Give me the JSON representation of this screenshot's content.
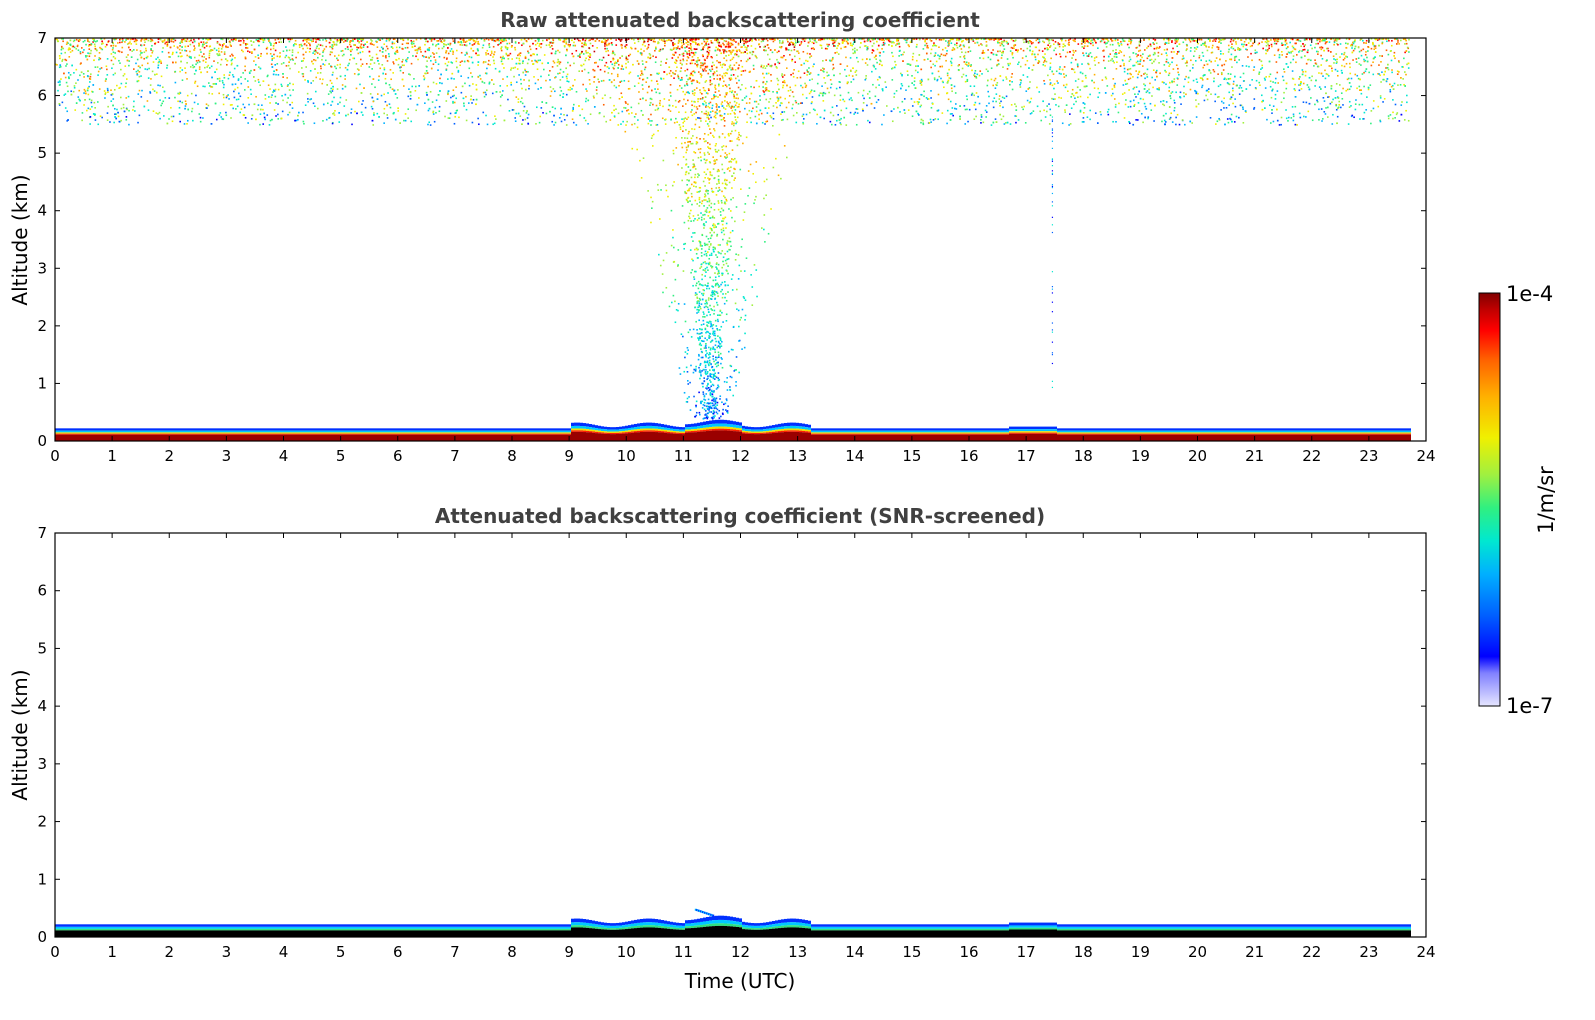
{
  "chart_data": [
    {
      "type": "heatmap",
      "title": "Raw attenuated backscattering coefficient",
      "ylabel": "Altitude (km)",
      "xlabel": "",
      "xlim": [
        0,
        24
      ],
      "ylim": [
        0,
        7
      ],
      "x_ticks": [
        0,
        1,
        2,
        3,
        4,
        5,
        6,
        7,
        8,
        9,
        10,
        11,
        12,
        13,
        14,
        15,
        16,
        17,
        18,
        19,
        20,
        21,
        22,
        23,
        24
      ],
      "y_ticks": [
        0,
        1,
        2,
        3,
        4,
        5,
        6,
        7
      ],
      "data_end_time": 23.7,
      "features": {
        "boundary_layer_top_km": 0.22,
        "upper_noise_base_km": 5.8,
        "plume_time_range": [
          11.0,
          12.1
        ]
      }
    },
    {
      "type": "heatmap",
      "title": "Attenuated backscattering coefficient (SNR-screened)",
      "ylabel": "Altitude (km)",
      "xlabel": "Time (UTC)",
      "xlim": [
        0,
        24
      ],
      "ylim": [
        0,
        7
      ],
      "x_ticks": [
        0,
        1,
        2,
        3,
        4,
        5,
        6,
        7,
        8,
        9,
        10,
        11,
        12,
        13,
        14,
        15,
        16,
        17,
        18,
        19,
        20,
        21,
        22,
        23,
        24
      ],
      "y_ticks": [
        0,
        1,
        2,
        3,
        4,
        5,
        6,
        7
      ],
      "data_end_time": 23.7,
      "features": {
        "boundary_layer_top_km": 0.22
      }
    }
  ],
  "colorbar": {
    "label": "1/m/sr",
    "max_label": "1e-4",
    "min_label": "1e-7",
    "scale": "log",
    "colors": [
      "#e6e6ff",
      "#b3b3ff",
      "#8080ff",
      "#0000ff",
      "#0060ff",
      "#00b0ff",
      "#00e8d0",
      "#30f080",
      "#a0f040",
      "#f0f000",
      "#ffb000",
      "#ff6000",
      "#ff0000",
      "#c00000",
      "#800000"
    ]
  }
}
